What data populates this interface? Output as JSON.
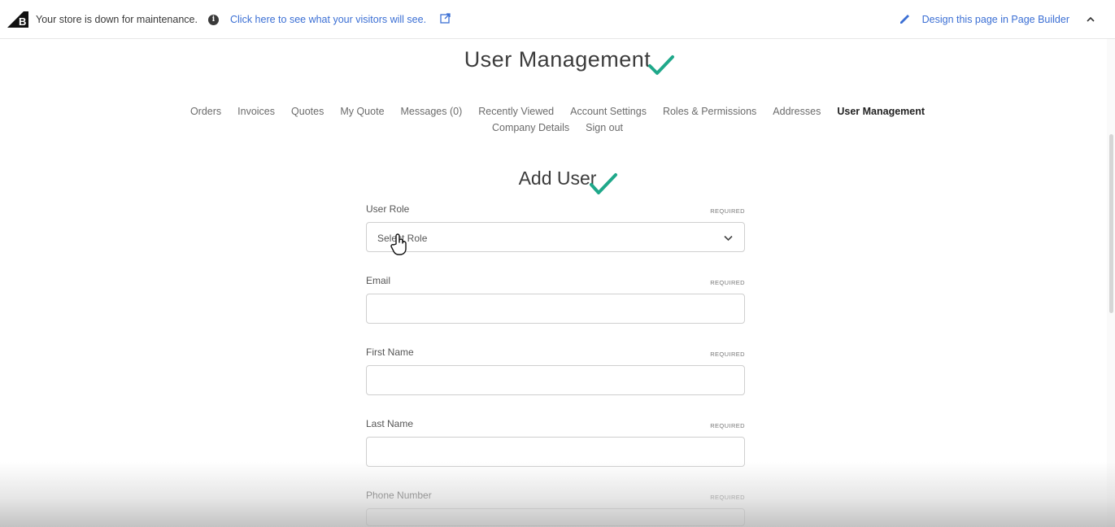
{
  "topbar": {
    "maintenance_text": "Your store is down for maintenance.",
    "visitors_link": "Click here to see what your visitors will see.",
    "design_link": "Design this page in Page Builder"
  },
  "page": {
    "title": "User Management"
  },
  "nav": {
    "row1": [
      {
        "label": "Orders",
        "active": false
      },
      {
        "label": "Invoices",
        "active": false
      },
      {
        "label": "Quotes",
        "active": false
      },
      {
        "label": "My Quote",
        "active": false
      },
      {
        "label": "Messages (0)",
        "active": false
      },
      {
        "label": "Recently Viewed",
        "active": false
      },
      {
        "label": "Account Settings",
        "active": false
      },
      {
        "label": "Roles & Permissions",
        "active": false
      },
      {
        "label": "Addresses",
        "active": false
      },
      {
        "label": "User Management",
        "active": true
      }
    ],
    "row2": [
      {
        "label": "Company Details",
        "active": false
      },
      {
        "label": "Sign out",
        "active": false
      }
    ]
  },
  "form": {
    "title": "Add User",
    "required_text": "REQUIRED",
    "fields": [
      {
        "label": "User Role",
        "type": "select",
        "value": "Select Role"
      },
      {
        "label": "Email",
        "type": "text",
        "value": ""
      },
      {
        "label": "First Name",
        "type": "text",
        "value": ""
      },
      {
        "label": "Last Name",
        "type": "text",
        "value": ""
      },
      {
        "label": "Phone Number",
        "type": "text",
        "value": ""
      }
    ]
  },
  "colors": {
    "link": "#3b6fd4",
    "checkmark": "#1fa88a",
    "active_nav": "#222222"
  },
  "icons": {
    "logo": "bigcommerce-logo",
    "info": "info-icon",
    "external": "external-link-icon",
    "pencil": "pencil-icon",
    "collapse": "chevron-up-icon",
    "select": "chevron-down-icon",
    "cursor": "hand-cursor-icon",
    "annotation": "checkmark-icon"
  }
}
